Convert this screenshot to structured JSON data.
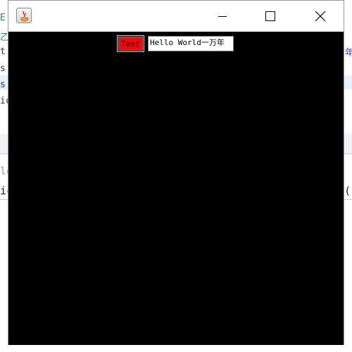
{
  "background_ide": {
    "left_fragments": [
      "E",
      "乙",
      "t",
      "s",
      "s",
      "ic",
      "lo",
      "ic"
    ],
    "right_fragments": [
      "年",
      "("
    ]
  },
  "window": {
    "title": "",
    "client_background": "#000000",
    "button": {
      "label": "Test",
      "color": "#ff0000"
    },
    "text_field": {
      "value": "Hello World一万年"
    },
    "controls": {
      "minimize": "minimize-icon",
      "maximize": "maximize-icon",
      "close": "close-icon"
    }
  }
}
